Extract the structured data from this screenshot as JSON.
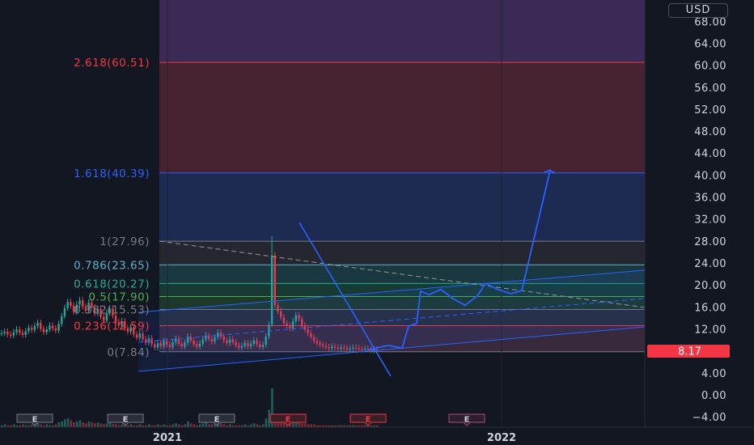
{
  "header": {
    "currency": "USD"
  },
  "price_tag": {
    "value": "8.17",
    "color": "#f23645"
  },
  "chart_data": {
    "type": "candlestick",
    "title": "",
    "xlabel": "",
    "ylabel": "",
    "ylim": [
      -5.3,
      71.4
    ],
    "y_ticks": [
      "68.00",
      "64.00",
      "60.00",
      "56.00",
      "52.00",
      "48.00",
      "44.00",
      "40.00",
      "36.00",
      "32.00",
      "28.00",
      "24.00",
      "20.00",
      "16.00",
      "12.00",
      "8.00",
      "4.00",
      "0.00",
      "−4.00"
    ],
    "x_ticks": [
      "2021",
      "2022"
    ],
    "fib_levels": [
      {
        "ratio": "2.618",
        "price": 60.51,
        "label": "2.618(60.51)",
        "text_color": "#f23645",
        "fill": "#4a2331",
        "line": "#f23645"
      },
      {
        "ratio": "1.618",
        "price": 40.39,
        "label": "1.618(40.39)",
        "text_color": "#2962ff",
        "fill": "#1d2b55",
        "line": "#2962ff"
      },
      {
        "ratio": "1",
        "price": 27.96,
        "label": "1(27.96)",
        "text_color": "#787b86",
        "fill": "#252831",
        "line": "#787b86"
      },
      {
        "ratio": "0.786",
        "price": 23.65,
        "label": "0.786(23.65)",
        "text_color": "#5fb0c9",
        "fill": "#1a3a42",
        "line": "#5fb0c9"
      },
      {
        "ratio": "0.618",
        "price": 20.27,
        "label": "0.618(20.27)",
        "text_color": "#22ab94",
        "fill": "#173c35",
        "line": "#22ab94"
      },
      {
        "ratio": "0.5",
        "price": 17.9,
        "label": "0.5(17.90)",
        "text_color": "#4caf50",
        "fill": "#1f3a2c",
        "line": "#4caf50"
      },
      {
        "ratio": "0.382",
        "price": 15.53,
        "label": "0.382(15.53)",
        "text_color": "#787b86",
        "fill": "#2a2d3a",
        "line": "#787b86"
      },
      {
        "ratio": "0.236",
        "price": 12.59,
        "label": "0.236(12.59)",
        "text_color": "#f23645",
        "fill": "#3a2a3e",
        "line": "#f23645"
      },
      {
        "ratio": "0",
        "price": 7.84,
        "label": "0(7.84)",
        "text_color": "#787b86",
        "fill": "#4a2331",
        "line": "#787b86"
      }
    ],
    "fib_top_zone": {
      "price": 71.4,
      "fill": "#3b2a55"
    },
    "candles_close": [
      11.2,
      11.5,
      11.0,
      10.8,
      11.4,
      11.9,
      11.3,
      10.9,
      11.6,
      12.2,
      11.8,
      12.5,
      13.1,
      12.0,
      11.4,
      11.9,
      12.6,
      12.1,
      11.7,
      12.9,
      14.3,
      15.8,
      16.9,
      16.2,
      15.1,
      16.4,
      17.2,
      16.0,
      15.3,
      16.8,
      15.9,
      14.8,
      15.6,
      14.2,
      13.5,
      14.9,
      15.7,
      14.4,
      13.2,
      12.6,
      13.4,
      12.1,
      11.5,
      12.3,
      11.0,
      10.4,
      11.2,
      10.1,
      9.5,
      10.3,
      9.2,
      8.6,
      9.4,
      8.9,
      9.8,
      9.1,
      8.7,
      9.6,
      10.2,
      9.3,
      8.8,
      9.5,
      10.6,
      9.9,
      9.2,
      8.8,
      9.3,
      10.1,
      10.8,
      10.2,
      9.7,
      10.5,
      11.3,
      10.6,
      9.9,
      9.4,
      10.1,
      9.6,
      9.0,
      8.6,
      8.9,
      9.4,
      8.8,
      9.3,
      9.9,
      9.2,
      8.7,
      9.1,
      10.6,
      12.8,
      25.4,
      16.3,
      15.2,
      14.1,
      13.0,
      12.6,
      12.1,
      13.4,
      14.5,
      13.8,
      12.7,
      11.9,
      11.2,
      10.5,
      9.8,
      9.4,
      9.1,
      8.9,
      8.7,
      8.5,
      8.8,
      8.6,
      8.4,
      8.6,
      8.5,
      8.3,
      8.4,
      8.6,
      8.5,
      8.3,
      8.2,
      8.4,
      8.3,
      8.1,
      8.3,
      8.17
    ],
    "volume": [
      2,
      3,
      2,
      2,
      3,
      2,
      2,
      3,
      2,
      2,
      3,
      2,
      4,
      3,
      2,
      3,
      2,
      2,
      3,
      5,
      6,
      8,
      9,
      7,
      5,
      6,
      7,
      5,
      4,
      6,
      5,
      4,
      5,
      4,
      3,
      4,
      5,
      3,
      3,
      2,
      3,
      2,
      2,
      3,
      2,
      2,
      3,
      2,
      2,
      3,
      2,
      2,
      3,
      2,
      3,
      2,
      2,
      3,
      4,
      3,
      2,
      3,
      6,
      4,
      3,
      2,
      3,
      4,
      5,
      3,
      3,
      4,
      7,
      4,
      3,
      2,
      3,
      2,
      2,
      2,
      2,
      3,
      2,
      3,
      4,
      3,
      2,
      3,
      9,
      18,
      40,
      12,
      8,
      7,
      6,
      5,
      5,
      6,
      7,
      5,
      4,
      4,
      3,
      3,
      3,
      2,
      2,
      2,
      2,
      2,
      2,
      2,
      2,
      2,
      2,
      2,
      2,
      2,
      2,
      2,
      2,
      2,
      2,
      2,
      2,
      2
    ],
    "earnings_markers": [
      {
        "label": "E",
        "type": "neutral"
      },
      {
        "label": "E",
        "type": "neutral"
      },
      {
        "label": "E",
        "type": "neutral"
      },
      {
        "label": "E",
        "type": "miss"
      },
      {
        "label": "E",
        "type": "miss"
      },
      {
        "label": "E",
        "type": "future"
      }
    ],
    "projection_path": [
      8.2,
      9.0,
      8.5,
      12.5,
      13.0,
      18.9,
      18.2,
      19.2,
      17.5,
      16.3,
      18.0,
      20.3,
      19.2,
      18.4,
      19.0,
      40.9
    ],
    "colors": {
      "up": "#26a69a",
      "down": "#f23645",
      "drawing": "#2962ff",
      "grid": "#1f2433"
    }
  }
}
